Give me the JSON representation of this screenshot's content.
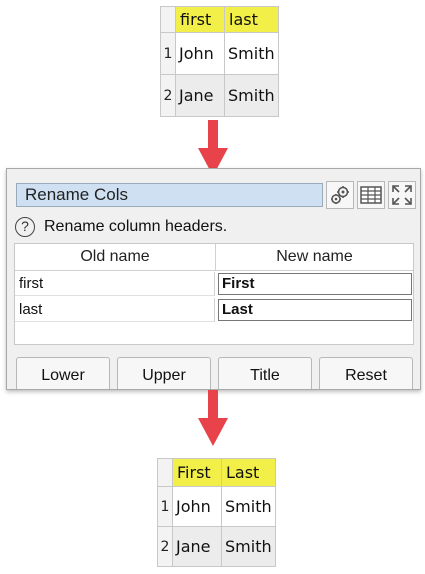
{
  "top_table": {
    "headers": [
      "first",
      "last"
    ],
    "rows": [
      {
        "num": "1",
        "cells": [
          "John",
          "Smith"
        ]
      },
      {
        "num": "2",
        "cells": [
          "Jane",
          "Smith"
        ]
      }
    ]
  },
  "rename_panel": {
    "title": "Rename Cols",
    "help_icon": "?",
    "help_text": "Rename column headers.",
    "columns": {
      "old": "Old name",
      "new": "New name"
    },
    "rows": [
      {
        "old": "first",
        "new": "First"
      },
      {
        "old": "last",
        "new": "Last"
      }
    ],
    "buttons": {
      "lower": "Lower",
      "upper": "Upper",
      "title": "Title",
      "reset": "Reset"
    },
    "toolbar_icons": [
      "gears-icon",
      "table-icon",
      "expand-icon"
    ]
  },
  "bottom_table": {
    "headers": [
      "First",
      "Last"
    ],
    "rows": [
      {
        "num": "1",
        "cells": [
          "John",
          "Smith"
        ]
      },
      {
        "num": "2",
        "cells": [
          "Jane",
          "Smith"
        ]
      }
    ]
  },
  "colors": {
    "header_yellow": "#f2ef48",
    "arrow_red": "#e8434a",
    "title_blue": "#cfe0f2"
  }
}
